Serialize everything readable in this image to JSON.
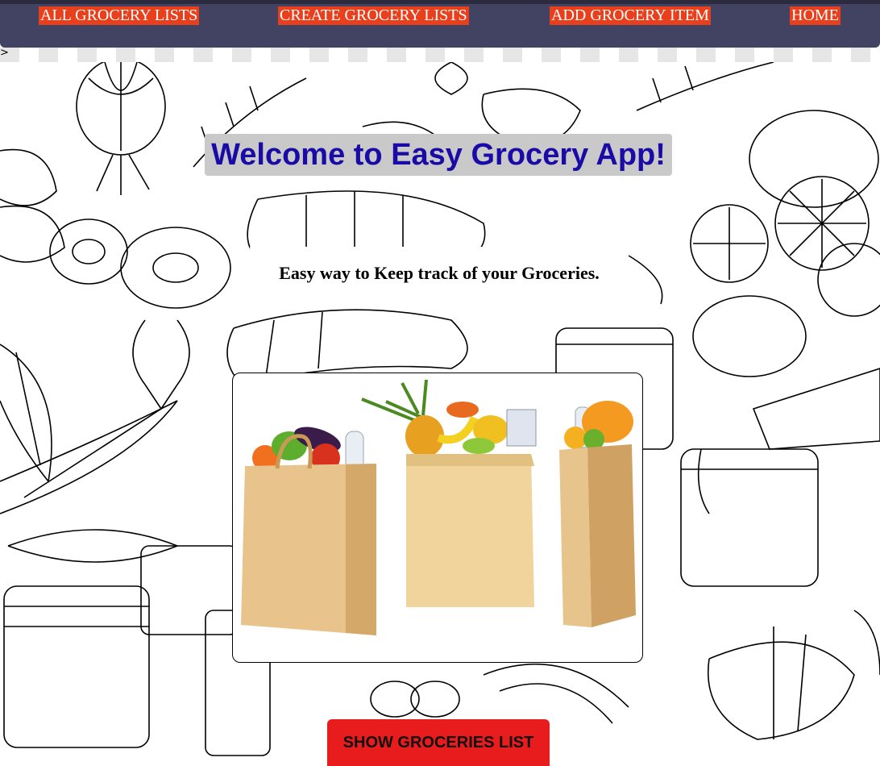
{
  "nav": {
    "all_lists": "ALL GROCERY LISTS",
    "create_lists": "CREATE GROCERY LISTS",
    "add_item": "ADD GROCERY ITEM",
    "home": "HOME"
  },
  "main": {
    "title": "Welcome to Easy Grocery App!",
    "tagline": "Easy way to Keep track of your Groceries.",
    "show_button": "SHOW GROCERIES LIST"
  },
  "colors": {
    "navbar": "#424262",
    "nav_link_bg": "#e8401c",
    "title_text": "#1a0aa6",
    "button": "#e81c1c"
  }
}
